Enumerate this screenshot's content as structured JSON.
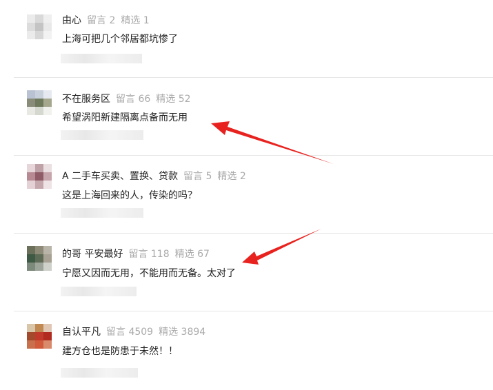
{
  "comments": [
    {
      "username": "由心",
      "stats": [
        "留言 2",
        "精选 1"
      ],
      "text": "上海可把几个邻居都坑惨了",
      "avatar_colors": [
        "#ecebeb",
        "#d8d9d8",
        "#efefef",
        "#dcdcdc",
        "#c3c4c3",
        "#e9e9e9",
        "#ebebeb",
        "#d7d7d7",
        "#f2f2f2"
      ]
    },
    {
      "username": "不在服务区",
      "stats": [
        "留言 66",
        "精选 52"
      ],
      "text": "希望涡阳新建隔离点备而无用",
      "avatar_colors": [
        "#b9c2d2",
        "#c8d0dc",
        "#e6eaf0",
        "#8a8c7a",
        "#6f7a5c",
        "#a6a88e",
        "#e8e9e3",
        "#d4d8cf",
        "#f1f1ee"
      ]
    },
    {
      "username": "A 二手车买卖、置换、贷款",
      "stats": [
        "留言 5",
        "精选 2"
      ],
      "text": "这是上海回来的人，传染的吗？",
      "avatar_colors": [
        "#e6d6d9",
        "#bfa2a8",
        "#eadfe1",
        "#b78a93",
        "#8f5b66",
        "#c6a5ac",
        "#e3d1d5",
        "#c5a8ae",
        "#eee3e5"
      ]
    },
    {
      "username": "的哥 平安最好",
      "stats": [
        "留言 118",
        "精选 67"
      ],
      "text": "宁愿又因而无用，不能用而无备。太对了",
      "avatar_colors": [
        "#6a705a",
        "#8e8a78",
        "#b8b4a8",
        "#3e5a44",
        "#5e6b56",
        "#a6a192",
        "#7b8a7a",
        "#9da49a",
        "#cfd1cb"
      ]
    },
    {
      "username": "自认平凡",
      "stats": [
        "留言 4509",
        "精选 3894"
      ],
      "text": "建方仓也是防患于未然！！",
      "avatar_colors": [
        "#d9c6a8",
        "#c08a52",
        "#e0c7b4",
        "#a44a2c",
        "#c0392b",
        "#b02a20",
        "#c8704c",
        "#d15a3a",
        "#d88a6a"
      ]
    }
  ]
}
